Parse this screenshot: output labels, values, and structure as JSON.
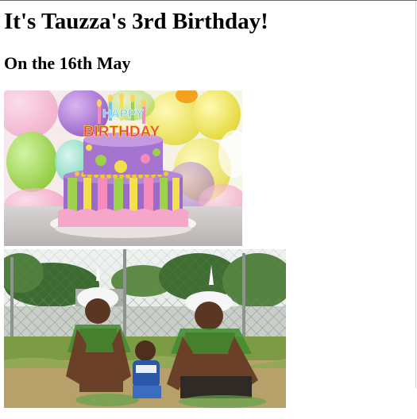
{
  "page": {
    "heading": "It's Tauzza's 3rd Birthday!",
    "subheading": "On the 16th May"
  },
  "images": [
    {
      "name": "birthday-cake-photo",
      "topper_text": [
        "HAPPY",
        "BIRTHDAY"
      ]
    },
    {
      "name": "children-costume-photo"
    }
  ]
}
